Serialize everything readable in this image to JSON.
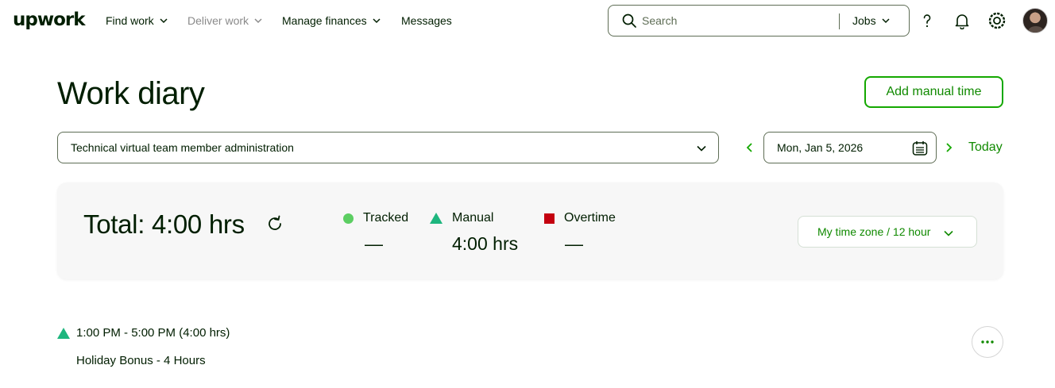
{
  "nav": {
    "logo": "upwork",
    "items": [
      {
        "label": "Find work",
        "state": "normal"
      },
      {
        "label": "Deliver work",
        "state": "muted"
      },
      {
        "label": "Manage finances",
        "state": "normal"
      },
      {
        "label": "Messages",
        "state": "normal"
      }
    ],
    "search": {
      "placeholder": "Search",
      "scope": "Jobs"
    },
    "icons": [
      "help-icon",
      "bell-icon",
      "settings-icon",
      "avatar"
    ]
  },
  "page": {
    "title": "Work diary",
    "add_manual_time_label": "Add manual time"
  },
  "controls": {
    "contract": "Technical virtual team member administration",
    "date": "Mon, Jan 5, 2026",
    "today_label": "Today"
  },
  "summary": {
    "total": "Total: 4:00 hrs",
    "tracked_label": "Tracked",
    "tracked_value": "—",
    "manual_label": "Manual",
    "manual_value": "4:00 hrs",
    "overtime_label": "Overtime",
    "overtime_value": "—",
    "timezone": "My time zone / 12 hour"
  },
  "entries": [
    {
      "time": "1:00 PM - 5:00 PM (4:00 hrs)",
      "description": "Holiday Bonus - 4 Hours",
      "type": "manual"
    }
  ],
  "colors": {
    "brand_green": "#14a800",
    "link_green": "#108a00",
    "tracked": "#5cce62",
    "manual": "#1eb67e",
    "overtime": "#c4000f",
    "text": "#001e00"
  }
}
